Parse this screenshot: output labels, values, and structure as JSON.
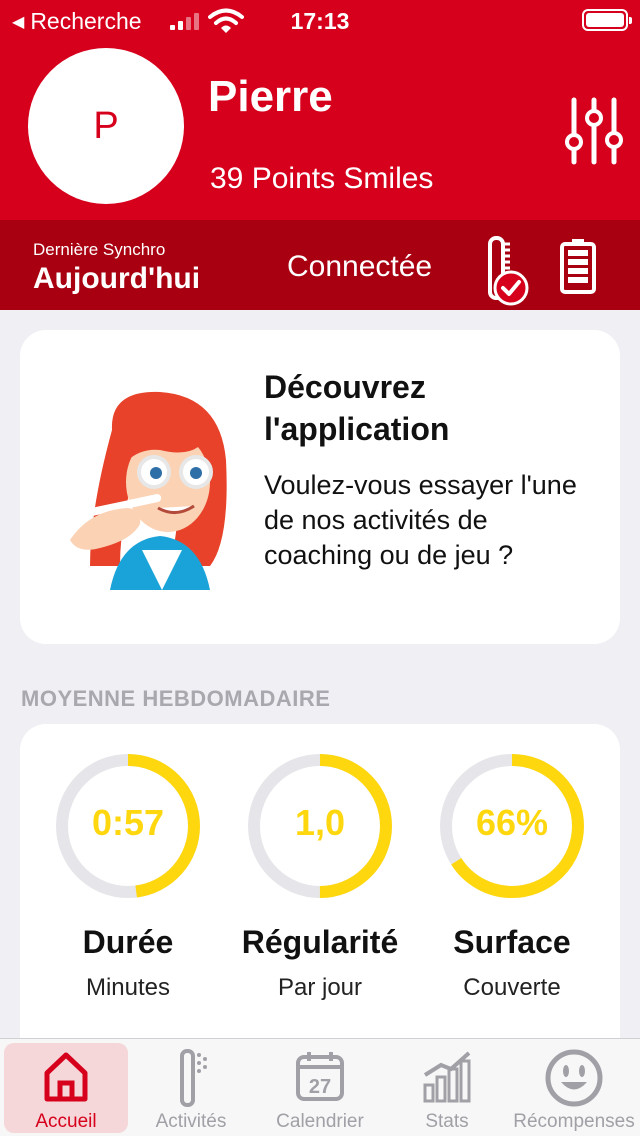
{
  "status_bar": {
    "back_label": "Recherche",
    "time": "17:13"
  },
  "profile": {
    "avatar_initial": "P",
    "name": "Pierre",
    "points": "39 Points Smiles"
  },
  "sync": {
    "label": "Dernière Synchro",
    "value": "Aujourd'hui",
    "connection": "Connectée"
  },
  "promo": {
    "title": "Découvrez l'application",
    "text": "Voulez-vous essayer l'une de nos activités de coaching ou de jeu ?"
  },
  "weekly": {
    "section_title": "MOYENNE HEBDOMADAIRE",
    "stats": [
      {
        "value": "0:57",
        "label": "Durée",
        "sub": "Minutes",
        "progress": 0.48
      },
      {
        "value": "1,0",
        "label": "Régularité",
        "sub": "Par jour",
        "progress": 0.5
      },
      {
        "value": "66%",
        "label": "Surface",
        "sub": "Couverte",
        "progress": 0.66
      }
    ]
  },
  "tabs": [
    {
      "label": "Accueil",
      "icon": "home-icon",
      "active": true
    },
    {
      "label": "Activités",
      "icon": "toothbrush-icon"
    },
    {
      "label": "Calendrier",
      "icon": "calendar-icon",
      "day": "27"
    },
    {
      "label": "Stats",
      "icon": "stats-icon"
    },
    {
      "label": "Récompenses",
      "icon": "smiley-icon"
    }
  ],
  "colors": {
    "brand": "#d6001c",
    "brand_dark": "#a80010",
    "accent": "#ffd70f"
  }
}
